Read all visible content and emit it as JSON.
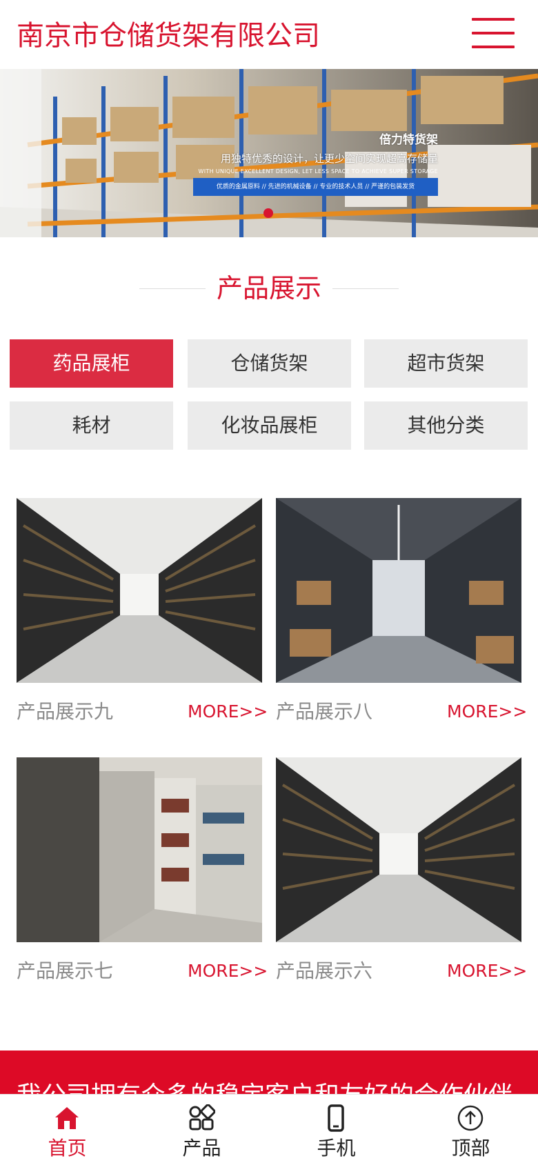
{
  "header": {
    "title": "南京市仓储货架有限公司",
    "menu_icon": "hamburger-menu-icon"
  },
  "banner": {
    "title": "倍力特货架",
    "subtitle": "用独特优秀的设计，让更少空间实现超高存储量",
    "subtitle_en": "WITH UNIQUE EXCELLENT DESIGN, LET LESS SPACE TO ACHIEVE SUPER STORAGE",
    "tagline": "优质的金属原料 // 先进的机械设备 // 专业的技术人员 // 严谨的包装发货"
  },
  "section": {
    "title": "产品展示"
  },
  "categories": [
    {
      "label": "药品展柜",
      "active": true
    },
    {
      "label": "仓储货架",
      "active": false
    },
    {
      "label": "超市货架",
      "active": false
    },
    {
      "label": "耗材",
      "active": false
    },
    {
      "label": "化妆品展柜",
      "active": false
    },
    {
      "label": "其他分类",
      "active": false
    }
  ],
  "products": [
    {
      "name": "产品展示九",
      "more": "MORE>>"
    },
    {
      "name": "产品展示八",
      "more": "MORE>>"
    },
    {
      "name": "产品展示七",
      "more": "MORE>>"
    },
    {
      "name": "产品展示六",
      "more": "MORE>>"
    }
  ],
  "band": {
    "text": "我公司拥有众多的稳定客户和友好的合作伙伴"
  },
  "bottom_nav": [
    {
      "label": "首页",
      "icon": "home-icon",
      "active": true
    },
    {
      "label": "产品",
      "icon": "grid-icon",
      "active": false
    },
    {
      "label": "手机",
      "icon": "phone-icon",
      "active": false
    },
    {
      "label": "顶部",
      "icon": "arrow-up-circle-icon",
      "active": false
    }
  ],
  "colors": {
    "brand_red": "#d8142f",
    "active_tab": "#db2c42",
    "tab_bg": "#ebebeb",
    "band_red": "#dd0a26"
  }
}
